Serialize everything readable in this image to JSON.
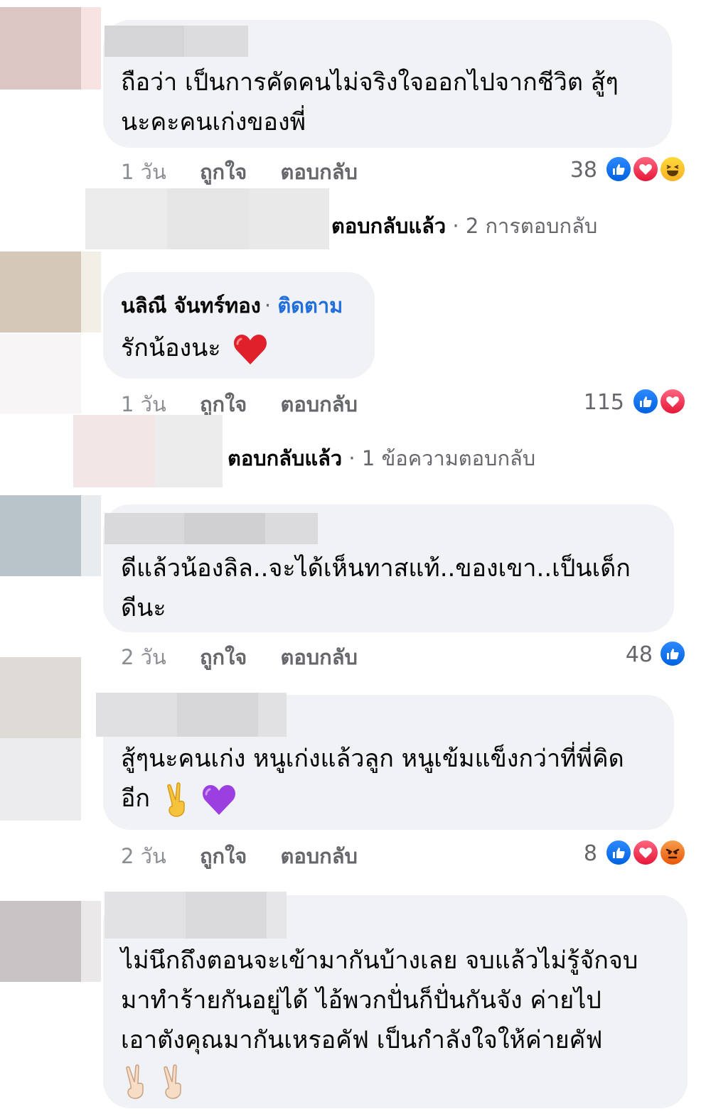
{
  "comments": [
    {
      "body_lines": [
        "ถือว่า เป็นการคัดคนไม่จริงใจออกไปจากชีวิต สู้ๆ",
        "นะคะคนเก่งของพี่"
      ],
      "time": "1 วัน",
      "like": "ถูกใจ",
      "reply": "ตอบกลับ",
      "reaction_count": "38",
      "reactions": [
        "like-icon",
        "love-icon",
        "haha-icon"
      ],
      "replies_label": "ตอบกลับแล้ว",
      "replies_count": "2 การตอบกลับ"
    },
    {
      "author": "นลิณี จันทร์ทอง",
      "follow": "ติดตาม",
      "body_lines": [
        "รักน้องนะ"
      ],
      "time": "1 วัน",
      "like": "ถูกใจ",
      "reply": "ตอบกลับ",
      "reaction_count": "115",
      "reactions": [
        "like-icon",
        "love-icon"
      ],
      "replies_label": "ตอบกลับแล้ว",
      "replies_count": "1 ข้อความตอบกลับ"
    },
    {
      "body_lines": [
        "ดีแล้วน้องลิล..จะได้เห็นทาสแท้..ของเขา..เป็นเด็ก",
        "ดีนะ"
      ],
      "time": "2 วัน",
      "like": "ถูกใจ",
      "reply": "ตอบกลับ",
      "reaction_count": "48",
      "reactions": [
        "like-icon"
      ]
    },
    {
      "body_lines": [
        "สู้ๆนะคนเก่ง หนูเก่งแล้วลูก หนูเข้มแข็งกว่าที่พี่คิด",
        "อีก"
      ],
      "time": "2 วัน",
      "like": "ถูกใจ",
      "reply": "ตอบกลับ",
      "reaction_count": "8",
      "reactions": [
        "like-icon",
        "love-icon",
        "angry-icon"
      ]
    },
    {
      "body_lines": [
        "ไม่นึกถึงตอนจะเข้ามากันบ้างเลย จบแล้วไม่รู้จักจบ",
        "มาทำร้ายกันอยู่ได้ ไอ้พวกปั่นก็ปั่นกันจัง ค่ายไป",
        "เอาตังคุณมากันเหรอคัฟ เป็นกำลังใจให้ค่ายคัฟ"
      ]
    }
  ],
  "colors": {
    "bubble": "#f0f2f5",
    "follow": "#216fdb",
    "meta": "#65676b",
    "like": "#1877f2",
    "love": "#f33e58"
  }
}
